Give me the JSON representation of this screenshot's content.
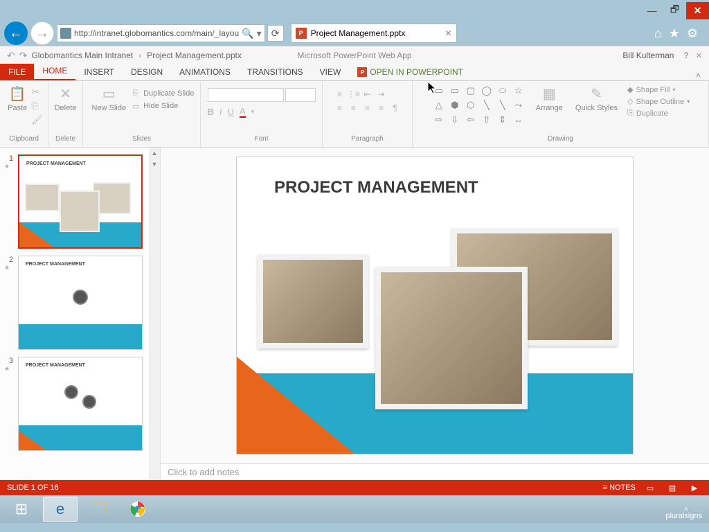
{
  "window": {
    "title": ""
  },
  "browser": {
    "url": "http://intranet.globomantics.com/main/_layou",
    "tab_title": "Project Management.pptx"
  },
  "breadcrumb": {
    "root": "Globomantics Main Intranet",
    "file": "Project Management.pptx"
  },
  "app": {
    "name": "Microsoft PowerPoint Web App",
    "user": "Bill Kulterman"
  },
  "tabs": {
    "file": "FILE",
    "home": "HOME",
    "insert": "INSERT",
    "design": "DESIGN",
    "animations": "ANIMATIONS",
    "transitions": "TRANSITIONS",
    "view": "VIEW",
    "open": "OPEN IN POWERPOINT"
  },
  "ribbon": {
    "paste": "Paste",
    "delete": "Delete",
    "new_slide": "New Slide",
    "duplicate_slide": "Duplicate Slide",
    "hide_slide": "Hide Slide",
    "arrange": "Arrange",
    "quick_styles": "Quick Styles",
    "shape_fill": "Shape Fill",
    "shape_outline": "Shape Outline",
    "duplicate": "Duplicate",
    "groups": {
      "clipboard": "Clipboard",
      "delete": "Delete",
      "slides": "Slides",
      "font": "Font",
      "paragraph": "Paragraph",
      "drawing": "Drawing"
    }
  },
  "slides": [
    {
      "num": "1",
      "title": "PROJECT MANAGEMENT"
    },
    {
      "num": "2",
      "title": "PROJECT MANAGEMENT"
    },
    {
      "num": "3",
      "title": "PROJECT MANAGEMENT"
    }
  ],
  "main_slide": {
    "title": "PROJECT MANAGEMENT"
  },
  "notes_placeholder": "Click to add notes",
  "status": {
    "slide_counter": "SLIDE 1 OF 16",
    "notes": "NOTES"
  },
  "total_slides": 16,
  "watermark": "pluralsigns"
}
